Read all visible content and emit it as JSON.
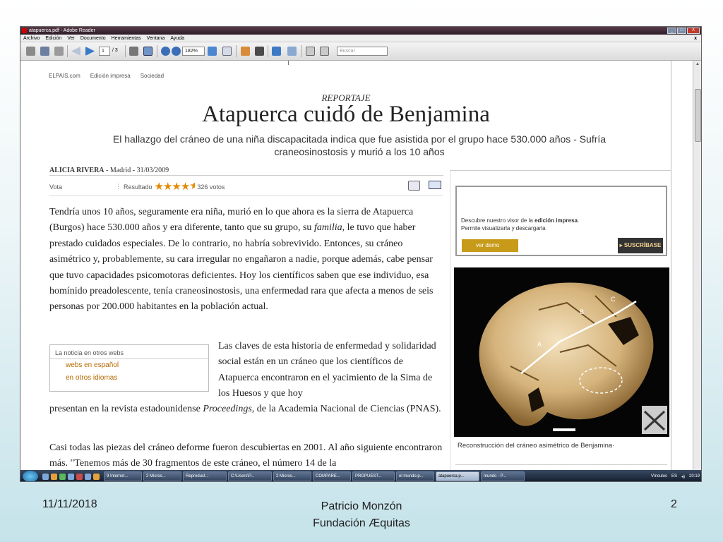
{
  "window": {
    "title": "atapuerca.pdf - Adobe Reader",
    "buttons": [
      "_",
      "□",
      "X"
    ]
  },
  "menu": {
    "items": [
      "Archivo",
      "Edición",
      "Ver",
      "Documento",
      "Herramientas",
      "Ventana",
      "Ayuda"
    ],
    "close": "x"
  },
  "toolbar": {
    "page_current": "1",
    "page_total": "/ 3",
    "zoom": "182%",
    "search_placeholder": "Buscar"
  },
  "article": {
    "nav": [
      "ELPAIS.com",
      "Edición impresa",
      "Sociedad"
    ],
    "kicker": "REPORTAJE",
    "headline": "Atapuerca cuidó de Benjamina",
    "subtitle": "El hallazgo del cráneo de una niña discapacitada indica que fue asistida por el grupo hace 530.000 años - Sufría craneosinostosis y murió a los 10 años",
    "author": "ALICIA RIVERA",
    "byline_rest": " - Madrid - 31/03/2009",
    "vote_label": "Vota",
    "result_label": "Resultado",
    "stars": "★★★★",
    "half_star": "★",
    "rating_fraction": 0.85,
    "votes": "326 votos",
    "p1_a": "Tendría unos 10 años, seguramente era niña, murió en lo que ahora es la sierra de Atapuerca (Burgos) hace 530.000 años y era diferente, tanto que su grupo, su ",
    "p1_em": "familia",
    "p1_b": ", le tuvo que haber prestado cuidados especiales. De lo contrario, no habría sobrevivido. Entonces, su cráneo asimétrico y, probablemente, su cara irregular no engañaron a nadie, porque además, cabe pensar que tuvo capacidades psicomotoras deficientes. Hoy los científicos saben que ese individuo, esa homínido preadolescente, tenía craneosinostosis, una enfermedad rara que afecta a menos de seis personas por 200.000 habitantes en la población actual.",
    "p2_a": "Las claves de esta historia de enfermedad y solidaridad social están en un cráneo que los científicos de Atapuerca encontraron en el yacimiento de la Sima de los Huesos y que hoy",
    "p2_b": "presentan en la revista estadounidense ",
    "p2_em": "Proceedings",
    "p2_c": ", de la Academia Nacional de Ciencias (PNAS).",
    "p3": "Casi todas las piezas del cráneo deforme fueron descubiertas en 2001. Al año siguiente encontraron más. \"Tenemos más de 30 fragmentos de este cráneo, el número 14 de la",
    "other_webs": {
      "title": "La noticia en otros webs",
      "links": [
        "webs en español",
        "en otros idiomas"
      ]
    },
    "ad": {
      "line1_a": "Descubre nuestro visor de la ",
      "line1_b": "edición impresa",
      "line1_c": ".",
      "line2": "Permite visualizarla y descargarla",
      "demo_btn": "ver demo",
      "subscribe_btn": "SUSCRÍBASE"
    },
    "photo_labels": [
      "A",
      "B",
      "C"
    ],
    "caption": "Reconstrucción del cráneo asimétrico de Benjamina·"
  },
  "taskbar": {
    "tasks": [
      "9 Internet...",
      "2 Micros...",
      "Reproduct...",
      "C:\\Users\\P...",
      "2 Micros...",
      "COMPARE...",
      "PROPUEST...",
      "el mundo.p...",
      "atapuerca.p...",
      "mundo - P..."
    ],
    "active_index": 8,
    "links_label": "Vínculos",
    "lang": "ES",
    "clock": "20:19"
  },
  "footer": {
    "date": "11/11/2018",
    "author": "Patricio Monzón",
    "org": "Fundación Æquitas",
    "slide_number": "2"
  }
}
